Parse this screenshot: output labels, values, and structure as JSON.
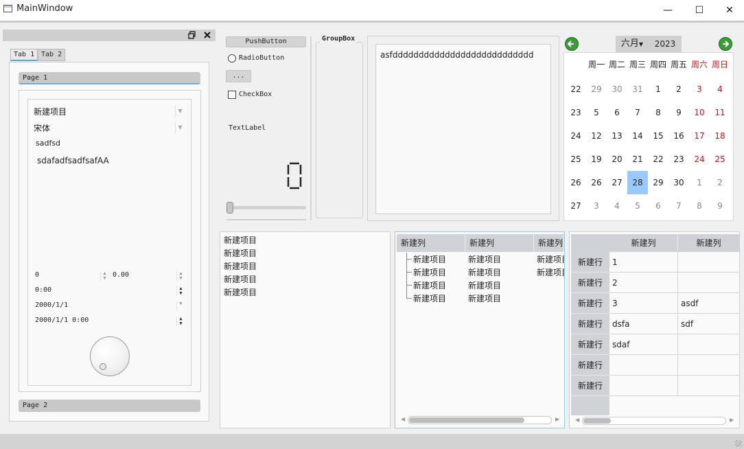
{
  "window": {
    "title": "MainWindow",
    "minimize": "—",
    "maximize": "☐",
    "close": "✕"
  },
  "dock": {
    "float_icon": "restore-icon",
    "close_icon": "close-icon"
  },
  "tabs": [
    {
      "label": "Tab 1"
    },
    {
      "label": "Tab 2"
    }
  ],
  "toolbox": {
    "page1": "Page 1",
    "page2": "Page 2"
  },
  "form": {
    "combo1": "新建项目",
    "font_combo": "宋体",
    "line_edit": "sadfsd",
    "text_edit": "sdafadfsadfsafAA",
    "spin_int": "0",
    "spin_double": "0.00",
    "time_edit": "0:00",
    "date_edit": "2000/1/1",
    "datetime_edit": "2000/1/1 0:00"
  },
  "widgets": {
    "push_button": "PushButton",
    "radio_button": "RadioButton",
    "tool_button": "...",
    "check_box": "CheckBox",
    "text_label": "TextLabel",
    "lcd_value": "0",
    "slider_value": 0,
    "group_box": "GroupBox"
  },
  "plain_text": "asfddddddddddddddddddddddddddd",
  "calendar": {
    "month": "六月",
    "year": "2023",
    "weekdays": [
      "周一",
      "周二",
      "周三",
      "周四",
      "周五",
      "周六",
      "周日"
    ],
    "weeks": [
      {
        "num": "22",
        "days": [
          "29",
          "30",
          "31",
          "1",
          "2",
          "3",
          "4"
        ]
      },
      {
        "num": "23",
        "days": [
          "5",
          "6",
          "7",
          "8",
          "9",
          "10",
          "11"
        ]
      },
      {
        "num": "24",
        "days": [
          "12",
          "13",
          "14",
          "15",
          "16",
          "17",
          "18"
        ]
      },
      {
        "num": "25",
        "days": [
          "19",
          "20",
          "21",
          "22",
          "23",
          "24",
          "25"
        ]
      },
      {
        "num": "26",
        "days": [
          "26",
          "27",
          "28",
          "29",
          "30",
          "1",
          "2"
        ]
      },
      {
        "num": "27",
        "days": [
          "3",
          "4",
          "5",
          "6",
          "7",
          "8",
          "9"
        ]
      }
    ],
    "selected": "28",
    "colors": {
      "weekend": "#d01010",
      "other_month": "#8a8a8a",
      "selected_bg": "#99c9ff"
    }
  },
  "list_items": [
    "新建项目",
    "新建项目",
    "新建项目",
    "新建项目",
    "新建项目"
  ],
  "tree": {
    "headers": [
      "新建列",
      "新建列",
      "新建列"
    ],
    "rows": [
      [
        "新建项目",
        "新建项目",
        "新建项目"
      ],
      [
        "新建项目",
        "新建项目",
        "新建项目"
      ],
      [
        "新建项目",
        "新建项目",
        ""
      ],
      [
        "新建项目",
        "新建项目",
        ""
      ]
    ]
  },
  "table": {
    "col_headers": [
      "新建列",
      "新建列"
    ],
    "row_header": "新建行",
    "rows": [
      [
        "1",
        ""
      ],
      [
        "2",
        ""
      ],
      [
        "3",
        "asdf"
      ],
      [
        "dsfa",
        "sdf"
      ],
      [
        "sdaf",
        ""
      ],
      [
        "",
        ""
      ],
      [
        "",
        ""
      ]
    ]
  }
}
